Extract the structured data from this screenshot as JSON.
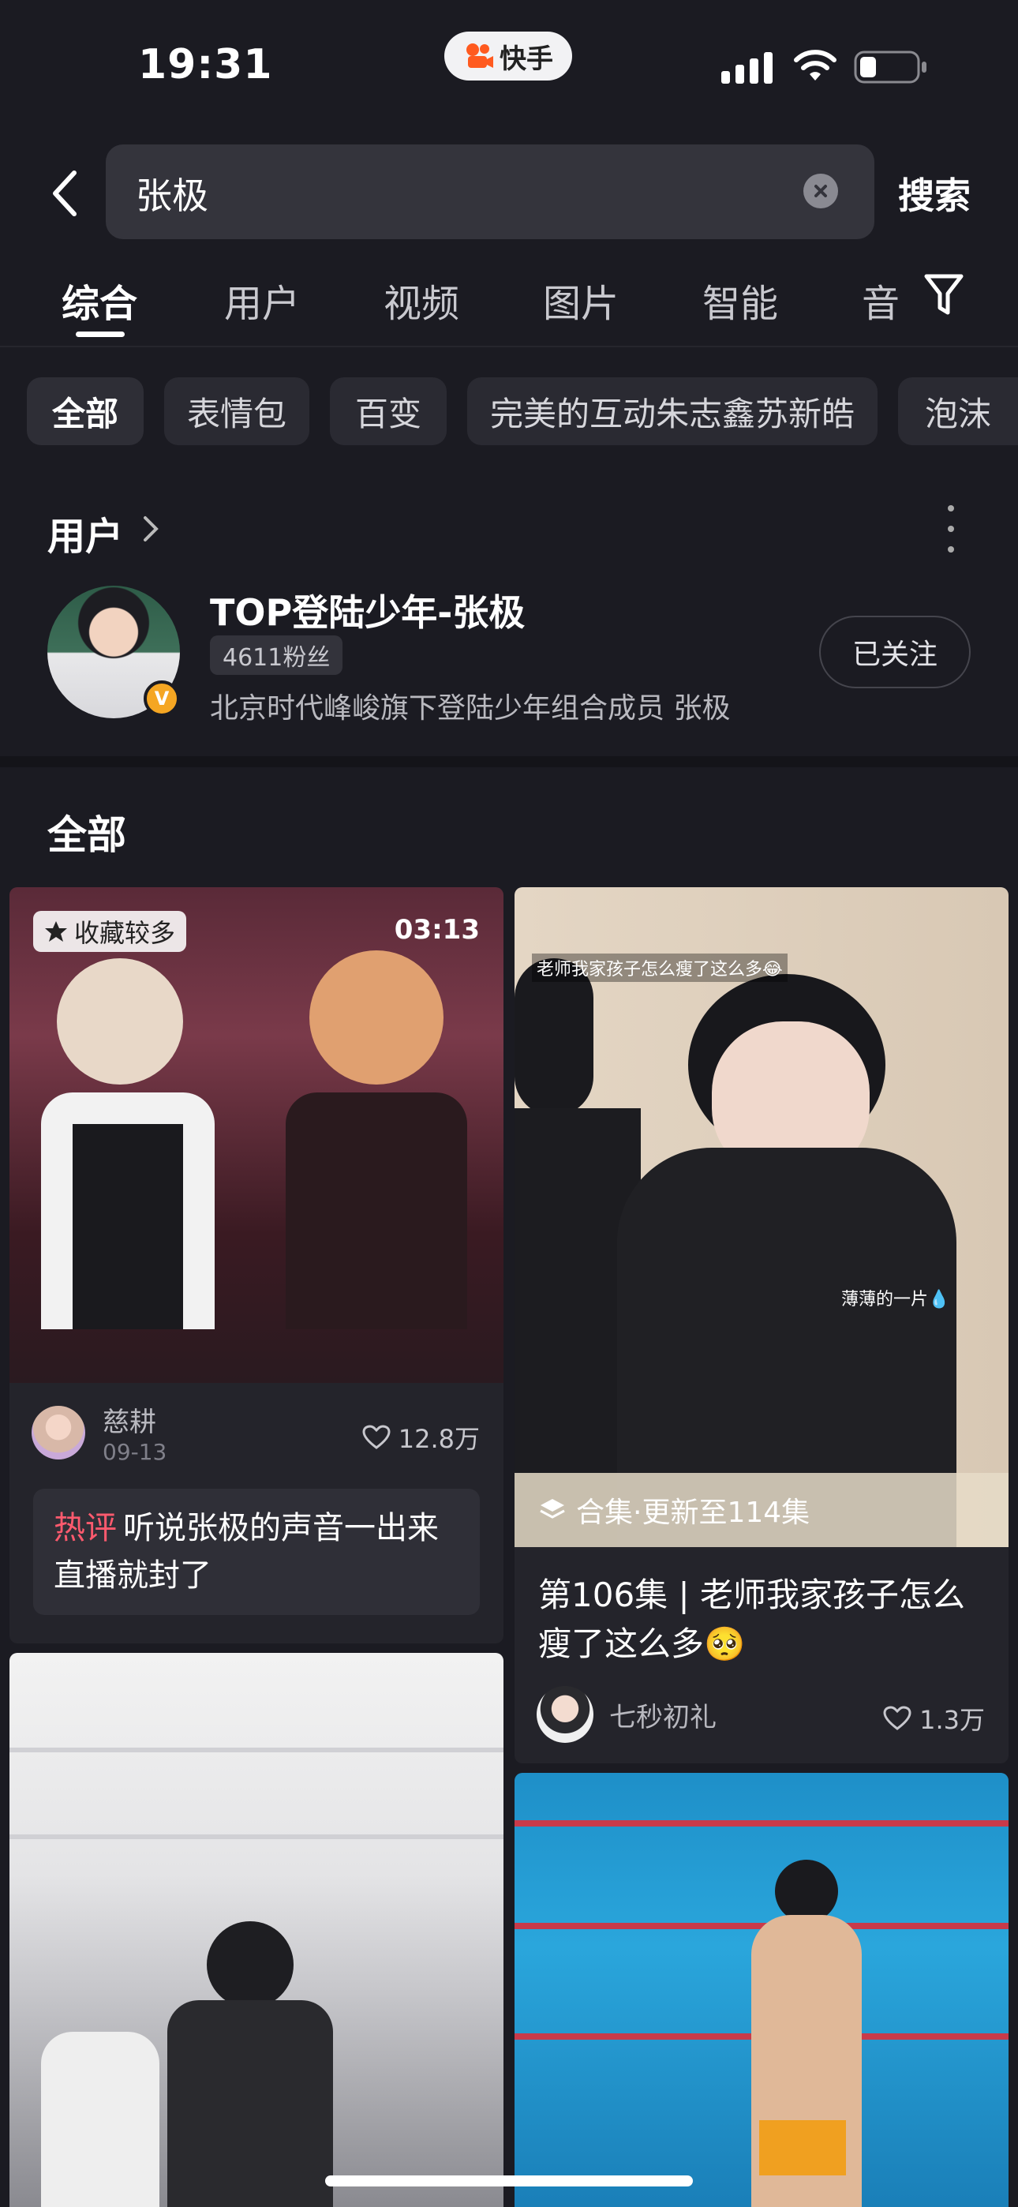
{
  "status_bar": {
    "time": "19:31",
    "app_name": "快手"
  },
  "search": {
    "query": "张极",
    "submit_label": "搜索"
  },
  "tabs": [
    "综合",
    "用户",
    "视频",
    "图片",
    "智能",
    "音"
  ],
  "chips": [
    "全部",
    "表情包",
    "百变",
    "完美的互动朱志鑫苏新皓",
    "泡沫"
  ],
  "user_section": {
    "title": "用户",
    "user": {
      "name": "TOP登陆少年-张极",
      "fans": "4611粉丝",
      "description": "北京时代峰峻旗下登陆少年组合成员 张极",
      "follow_label": "已关注",
      "verified_mark": "V"
    }
  },
  "all_section": {
    "title": "全部"
  },
  "cards": [
    {
      "badge": "收藏较多",
      "duration": "03:13",
      "author": "慈耕",
      "date": "09-13",
      "likes": "12.8万",
      "hot_label": "热评",
      "hot_comment": "听说张极的声音一出来直播就封了"
    },
    {
      "overlay_top": "老师我家孩子怎么瘦了这么多😂",
      "overlay_mid": "薄薄的一片💧",
      "collection": "合集·更新至114集",
      "title": "第106集 | 老师我家孩子怎么瘦了这么多🥺",
      "author": "七秒初礼",
      "likes": "1.3万"
    }
  ],
  "colors": {
    "background": "#1b1b22",
    "hot": "#ff5a6e",
    "badge": "#f5a623"
  }
}
